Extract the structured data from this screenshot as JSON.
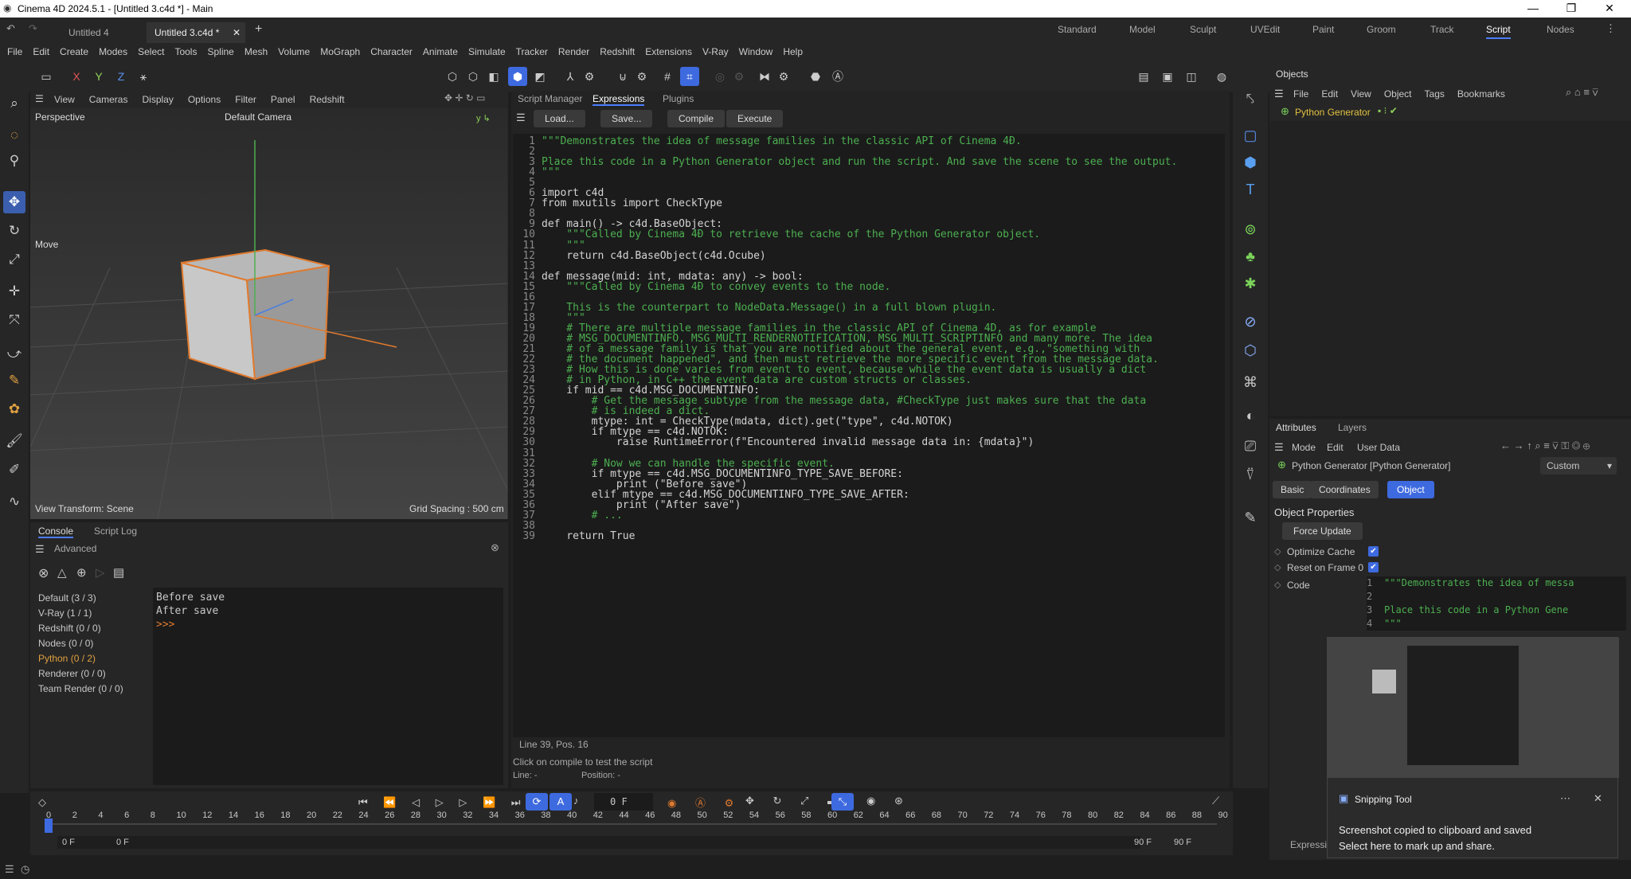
{
  "window": {
    "title": "Cinema 4D 2024.5.1 - [Untitled 3.c4d *] - Main"
  },
  "doc_tabs": [
    "Untitled 4",
    "Untitled 3.c4d *"
  ],
  "layouts": [
    "Standard",
    "Model",
    "Sculpt",
    "UVEdit",
    "Paint",
    "Groom",
    "Track",
    "Script",
    "Nodes"
  ],
  "menu": [
    "File",
    "Edit",
    "Create",
    "Modes",
    "Select",
    "Tools",
    "Spline",
    "Mesh",
    "Volume",
    "MoGraph",
    "Character",
    "Animate",
    "Simulate",
    "Tracker",
    "Render",
    "Redshift",
    "Extensions",
    "V-Ray",
    "Window",
    "Help"
  ],
  "viewport": {
    "menu": [
      "View",
      "Cameras",
      "Display",
      "Options",
      "Filter",
      "Panel",
      "Redshift"
    ],
    "name": "Perspective",
    "camera": "Default Camera",
    "move_label": "Move",
    "transform": "View Transform: Scene",
    "grid": "Grid Spacing : 500 cm"
  },
  "console": {
    "tabs": [
      "Console",
      "Script Log"
    ],
    "section": "Advanced",
    "channels": [
      "Default (3 / 3)",
      "V-Ray (1 / 1)",
      "Redshift (0 / 0)",
      "Nodes (0 / 0)",
      "Python (0 / 2)",
      "Renderer (0 / 0)",
      "Team Render  (0 / 0)"
    ],
    "output": [
      "Before save",
      "After save",
      ">>>"
    ]
  },
  "editor": {
    "tabs": [
      "Script Manager",
      "Expressions",
      "Plugins"
    ],
    "buttons": [
      "Load...",
      "Save...",
      "Compile",
      "Execute"
    ],
    "status": "Line 39, Pos. 16",
    "hint": "Click on compile to test the script",
    "line_label": "Line: -",
    "position_label": "Position: -"
  },
  "code": [
    "\"\"\"Demonstrates the idea of message families in the classic API of Cinema 4Đ.",
    "",
    "Place this code in a Python Generator object and run the script. And save the scene to see the output.",
    "\"\"\"",
    "",
    "import c4d",
    "from mxutils import CheckType",
    "",
    "def main() -> c4d.BaseObject:",
    "    \"\"\"Called by Cinema 4Đ to retrieve the cache of the Python Generator object.",
    "    \"\"\"",
    "    return c4d.BaseObject(c4d.Ocube)",
    "",
    "def message(mid: int, mdata: any) -> bool:",
    "    \"\"\"Called by Cinema 4Đ to convey events to the node.",
    "",
    "    This is the counterpart to NodeData.Message() in a full blown plugin.",
    "    \"\"\"",
    "    # There are multiple message families in the classic API of Cinema 4D, as for example",
    "    # MSG_DOCUMENTINFO, MSG_MULTI_RENDERNOTIFICATION, MSG_MULTI_SCRIPTINFO and many more. The idea",
    "    # of a message family is that you are notified about the general event, e.g.,\"something with",
    "    # the document happened\", and then must retrieve the more specific event from the message data.",
    "    # How this is done varies from event to event, because while the event data is usually a dict",
    "    # in Python, in C++ the event data are custom structs or classes.",
    "    if mid == c4d.MSG_DOCUMENTINFO:",
    "        # Get the message subtype from the message data, #CheckType just makes sure that the data",
    "        # is indeed a dict.",
    "        mtype: int = CheckType(mdata, dict).get(\"type\", c4d.NOTOK)",
    "        if mtype == c4d.NOTOK:",
    "            raise RuntimeError(f\"Encountered invalid message data in: {mdata}\")",
    "",
    "        # Now we can handle the specific event.",
    "        if mtype == c4d.MSG_DOCUMENTINFO_TYPE_SAVE_BEFORE:",
    "            print (\"Before save\")",
    "        elif mtype == c4d.MSG_DOCUMENTINFO_TYPE_SAVE_AFTER:",
    "            print (\"After save\")",
    "        # ...",
    "",
    "    return True"
  ],
  "objects": {
    "tab": "Objects",
    "menu": [
      "File",
      "Edit",
      "View",
      "Object",
      "Tags",
      "Bookmarks"
    ],
    "item": "Python Generator"
  },
  "attributes": {
    "tabs": [
      "Attributes",
      "Layers"
    ],
    "menu": [
      "Mode",
      "Edit",
      "User Data"
    ],
    "object": "Python Generator [Python Generator]",
    "preset": "Custom",
    "subtabs": [
      "Basic",
      "Coordinates",
      "Object"
    ],
    "section": "Object Properties",
    "force_update": "Force Update",
    "opt_cache": "Optimize Cache",
    "reset": "Reset on Frame 0",
    "code": "Code",
    "code_preview": [
      "\"\"\"Demonstrates the idea of messa",
      "",
      "Place this code in a Python Gene",
      "\"\"\""
    ],
    "footer": "Expressio"
  },
  "timeline": {
    "frame": "0 F",
    "ticks": [
      "0",
      "2",
      "4",
      "6",
      "8",
      "10",
      "12",
      "14",
      "16",
      "18",
      "20",
      "22",
      "24",
      "26",
      "28",
      "30",
      "32",
      "34",
      "36",
      "38",
      "40",
      "42",
      "44",
      "46",
      "48",
      "50",
      "52",
      "54",
      "56",
      "58",
      "60",
      "62",
      "64",
      "66",
      "68",
      "70",
      "72",
      "74",
      "76",
      "78",
      "80",
      "82",
      "84",
      "86",
      "88",
      "90"
    ],
    "start": "0 F",
    "start2": "0 F",
    "end": "90 F",
    "end2": "90 F"
  },
  "snip": {
    "title": "Snipping Tool",
    "line1": "Screenshot copied to clipboard and saved",
    "line2": "Select here to mark up and share."
  }
}
